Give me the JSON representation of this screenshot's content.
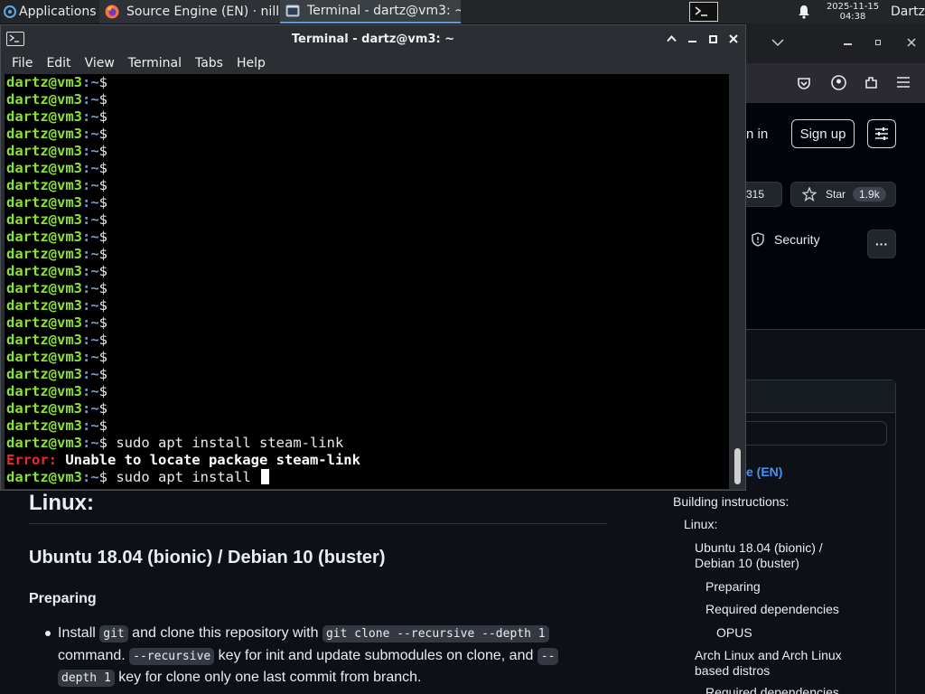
{
  "panel": {
    "applications": "Applications",
    "tasks": [
      {
        "label": "Source Engine (EN) · nill...",
        "icon": "firefox-icon"
      },
      {
        "label": "Terminal - dartz@vm3: ~",
        "icon": "terminal-icon"
      }
    ],
    "clock_date": "2025-11-15",
    "clock_time": "04:38",
    "user": "Dartz"
  },
  "terminal": {
    "title": "Terminal - dartz@vm3: ~",
    "menu": [
      "File",
      "Edit",
      "View",
      "Terminal",
      "Tabs",
      "Help"
    ],
    "prompt_user": "dartz@vm3",
    "prompt_path": ":~",
    "prompt_symbol": "$",
    "empty_prompt_count": 21,
    "history": [
      {
        "type": "prompt",
        "command": " sudo apt install steam-link"
      },
      {
        "type": "error",
        "label": "Error:",
        "message": " Unable to locate package steam-link"
      },
      {
        "type": "prompt",
        "command": " sudo apt install ",
        "cursor": true
      }
    ]
  },
  "browser": {
    "sign_in": "n in",
    "sign_up": "Sign up",
    "fork_count": "315",
    "star_label": "Star",
    "star_count": "1.9k",
    "security": "Security",
    "more": "···",
    "toc_active": "e (EN)",
    "toc": [
      {
        "text": "Building instructions:",
        "indent": 0
      },
      {
        "text": "Linux:",
        "indent": 1
      },
      {
        "text": "Ubuntu 18.04 (bionic) /",
        "indent": 2
      },
      {
        "text": "Debian 10 (buster)",
        "indent": 2
      },
      {
        "text": "Preparing",
        "indent": 3
      },
      {
        "text": "Required dependencies",
        "indent": 3
      },
      {
        "text": "OPUS",
        "indent": 4
      },
      {
        "text": "Arch Linux and Arch Linux",
        "indent": 2
      },
      {
        "text": "based distros",
        "indent": 2
      },
      {
        "text": "Required dependencies",
        "indent": 3
      }
    ],
    "article": {
      "h_linux": "Linux:",
      "h_ubuntu": "Ubuntu 18.04 (bionic) / Debian 10 (buster)",
      "h_preparing": "Preparing",
      "l1_a": "Install ",
      "l1_code1": "git",
      "l1_b": " and clone this repository with ",
      "l1_code2": "git clone --recursive --depth 1",
      "l2_a": "command. ",
      "l2_code": "--recursive",
      "l2_b": " key for init and update submodules on clone, and ",
      "l2_code2": "--",
      "l3_code": "depth 1",
      "l3_b": " key for clone only one last commit from branch."
    }
  }
}
